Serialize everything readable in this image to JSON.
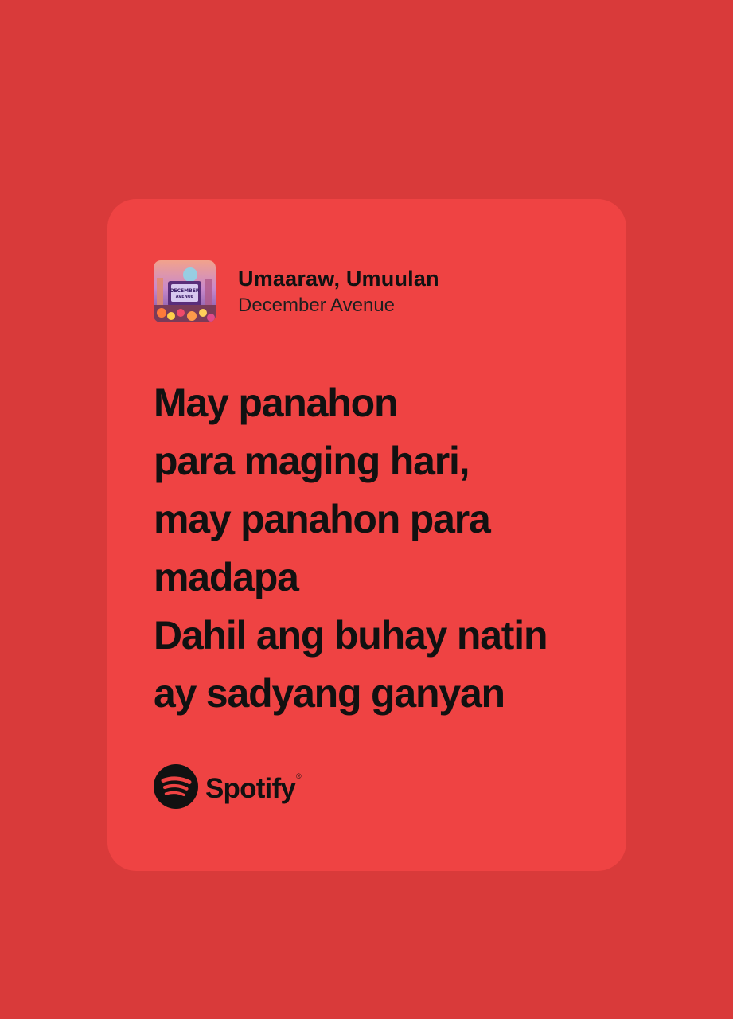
{
  "song": {
    "title": "Umaaraw, Umuulan",
    "artist": "December Avenue",
    "cover_art_text": "DECEMBER AVENUE"
  },
  "lyrics": [
    "May panahon",
    "para maging hari,",
    "may panahon para",
    "madapa",
    "Dahil ang buhay natin",
    "ay sadyang ganyan"
  ],
  "brand": {
    "name": "Spotify",
    "trademark": "®",
    "icon": "spotify-logo-icon"
  },
  "colors": {
    "background": "#d93a3a",
    "card": "#ef4343",
    "text": "#111111"
  }
}
